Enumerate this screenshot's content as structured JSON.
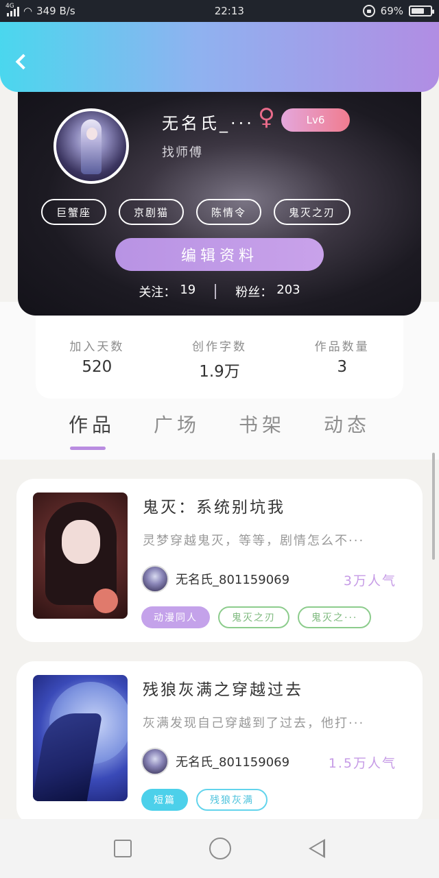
{
  "status_bar": {
    "network": "4G",
    "speed": "349 B/s",
    "time": "22:13",
    "battery": "69%",
    "battery_level": 0.69
  },
  "profile": {
    "username": "无名氏_···",
    "gender_symbol": "♀",
    "level": "Lv6",
    "bio": "找师傅",
    "tags": [
      "巨蟹座",
      "京剧猫",
      "陈情令",
      "鬼灭之刃"
    ],
    "edit_label": "编辑资料",
    "following_label": "关注：",
    "following_count": "19",
    "followers_label": "粉丝：",
    "followers_count": "203"
  },
  "stats": [
    {
      "label": "加入天数",
      "value": "520"
    },
    {
      "label": "创作字数",
      "value": "1.9万"
    },
    {
      "label": "作品数量",
      "value": "3"
    }
  ],
  "tabs": [
    "作品",
    "广场",
    "书架",
    "动态"
  ],
  "works": [
    {
      "title": "鬼灭：系统别坑我",
      "description": "灵梦穿越鬼灭，等等，剧情怎么不···",
      "author": "无名氏_801159069",
      "popularity": "3万人气",
      "tags": [
        "动漫同人",
        "鬼灭之刃",
        "鬼灭之···"
      ]
    },
    {
      "title": "残狼灰满之穿越过去",
      "description": "灰满发现自己穿越到了过去，他打···",
      "author": "无名氏_801159069",
      "popularity": "1.5万人气",
      "tags": [
        "短篇",
        "残狼灰满"
      ]
    }
  ],
  "colors": {
    "header_start": "#4ad7ee",
    "header_end": "#b18de3",
    "accent_purple": "#c4a2ea",
    "level_badge": "#f07c8f"
  }
}
